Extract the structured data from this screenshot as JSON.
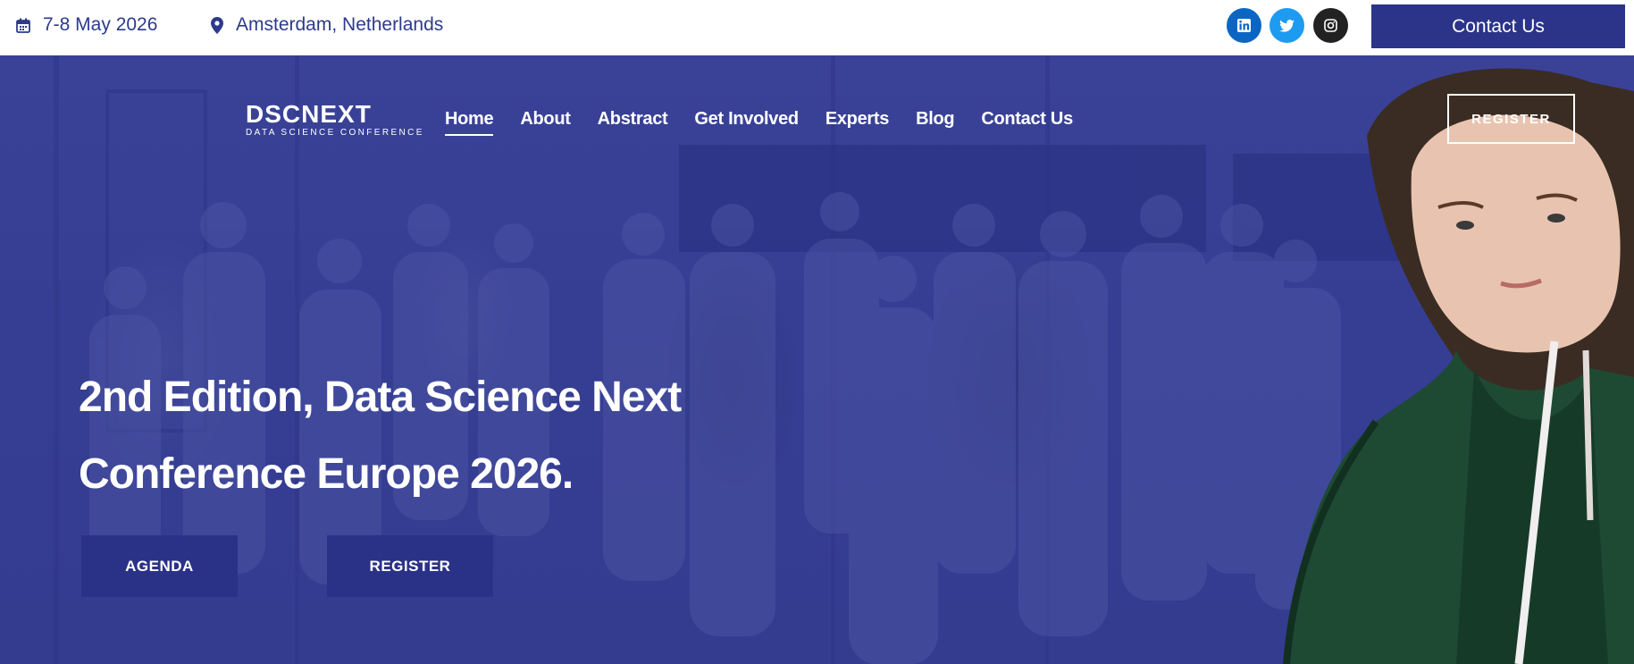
{
  "topbar": {
    "date": "7-8 May 2026",
    "location": "Amsterdam, Netherlands",
    "contact_button": "Contact Us",
    "social": [
      "linkedin-icon",
      "twitter-icon",
      "instagram-icon"
    ]
  },
  "logo": {
    "main": "DSCNEXT",
    "sub": "DATA SCIENCE CONFERENCE"
  },
  "nav": {
    "items": [
      "Home",
      "About",
      "Abstract",
      "Get Involved",
      "Experts",
      "Blog",
      "Contact Us"
    ],
    "active": "Home",
    "register_button": "REGISTER"
  },
  "hero": {
    "title_line1": "2nd Edition, Data Science Next",
    "title_line2": "Conference Europe 2026.",
    "agenda_button": "AGENDA",
    "register_button": "REGISTER"
  },
  "colors": {
    "brand": "#2b3488",
    "hero_overlay": "#363f94",
    "text_accent": "#2d3a8c"
  }
}
